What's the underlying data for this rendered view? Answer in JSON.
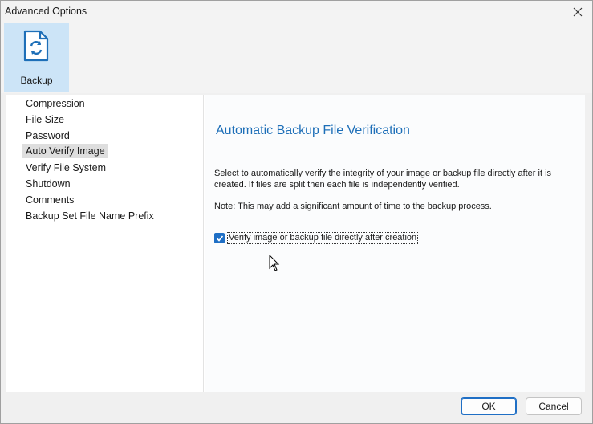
{
  "window": {
    "title": "Advanced Options"
  },
  "ribbon": {
    "backup_label": "Backup",
    "backup_icon": "backup-document-icon",
    "accent": "#cce4f7"
  },
  "nav": {
    "items": [
      {
        "label": "Compression",
        "selected": false
      },
      {
        "label": "File Size",
        "selected": false
      },
      {
        "label": "Password",
        "selected": false
      },
      {
        "label": "Auto Verify Image",
        "selected": true
      },
      {
        "label": "Verify File System",
        "selected": false
      },
      {
        "label": "Shutdown",
        "selected": false
      },
      {
        "label": "Comments",
        "selected": false
      },
      {
        "label": "Backup Set File Name Prefix",
        "selected": false
      }
    ]
  },
  "panel": {
    "title": "Automatic Backup File Verification",
    "title_color": "#1e6fb8",
    "description": "Select to automatically verify the integrity of your image or backup file directly after it is created. If files are split then each file is independently verified.",
    "note": "Note: This may add a significant amount of time to the backup process.",
    "verify_checkbox": {
      "label": "Verify image or backup file directly after creation",
      "checked": true
    }
  },
  "footer": {
    "ok_label": "OK",
    "cancel_label": "Cancel"
  }
}
